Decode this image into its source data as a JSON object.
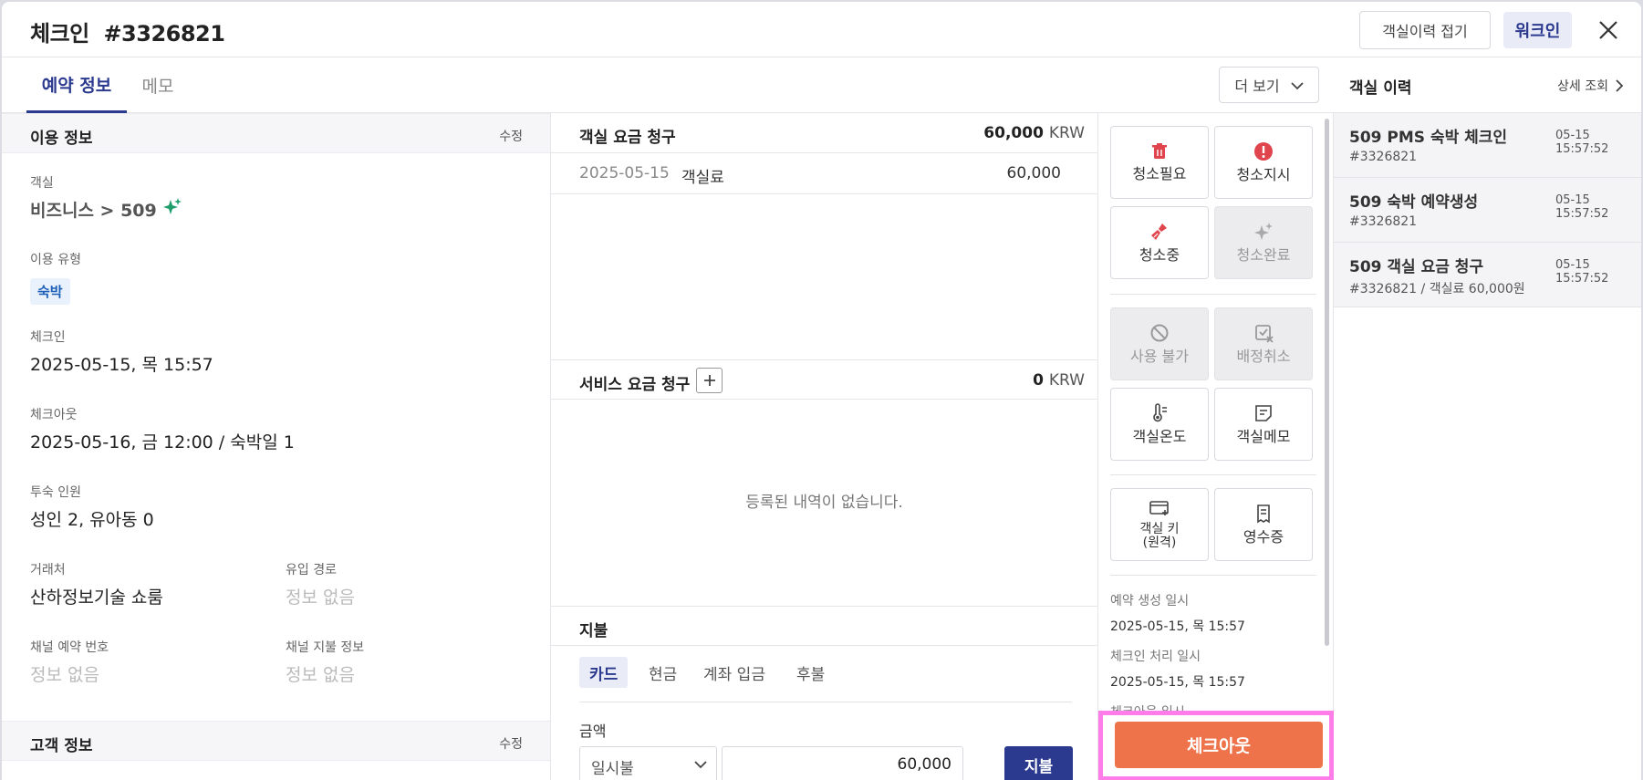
{
  "header": {
    "title": "체크인  #3326821",
    "history_toggle_label": "객실이력 접기",
    "walkin_label": "워크인"
  },
  "tabs": [
    {
      "label": "예약 정보"
    },
    {
      "label": "메모"
    }
  ],
  "more_label": "더 보기",
  "usage": {
    "title": "이용 정보",
    "edit_label": "수정",
    "room_label": "객실",
    "room_value": "비즈니스 > 509",
    "type_label": "이용 유형",
    "type_value": "숙박",
    "checkin_label": "체크인",
    "checkin_value": "2025-05-15, 목 15:57",
    "checkout_label": "체크아웃",
    "checkout_value": "2025-05-16, 금 12:00 / 숙박일 1",
    "guests_label": "투숙 인원",
    "guests_value": "성인 2, 유아동 0",
    "partner_label": "거래처",
    "partner_value": "산하정보기술 쇼룸",
    "inflow_label": "유입 경로",
    "inflow_value": "정보 없음",
    "channel_no_label": "채널 예약 번호",
    "channel_no_value": "정보 없음",
    "channel_pay_label": "채널 지불 정보",
    "channel_pay_value": "정보 없음"
  },
  "customer": {
    "title": "고객 정보",
    "edit_label": "수정"
  },
  "room_charge": {
    "title": "객실 요금 청구",
    "total": "60,000",
    "currency": "KRW",
    "rows": [
      {
        "date": "2025-05-15",
        "name": "객실료",
        "amount": "60,000"
      }
    ]
  },
  "service_charge": {
    "title": "서비스 요금 청구",
    "total": "0",
    "currency": "KRW",
    "empty_text": "등록된 내역이 없습니다."
  },
  "payment": {
    "title": "지불",
    "tabs": [
      "카드",
      "현금",
      "계좌 입금",
      "후불"
    ],
    "amount_label": "금액",
    "installment_value": "일시불",
    "amount_value": "60,000",
    "pay_label": "지불"
  },
  "actions": {
    "clean_needed": "청소필요",
    "clean_order": "청소지시",
    "cleaning": "청소중",
    "clean_done": "청소완료",
    "unavailable": "사용 불가",
    "unassign": "배정취소",
    "room_temp": "객실온도",
    "room_memo": "객실메모",
    "room_key_line1": "객실 키",
    "room_key_line2": "(원격)",
    "receipt": "영수증",
    "created_label": "예약 생성 일시",
    "created_value": "2025-05-15, 목 15:57",
    "checkin_proc_label": "체크인 처리 일시",
    "checkin_proc_value": "2025-05-15, 목 15:57",
    "checkout_proc_label": "체크아웃 일시",
    "checkout_label": "체크아웃"
  },
  "history": {
    "title": "객실 이력",
    "detail_label": "상세 조회",
    "items": [
      {
        "title": "509 PMS 숙박 체크인",
        "sub": "#3326821",
        "time": "05-15 15:57:52"
      },
      {
        "title": "509 숙박 예약생성",
        "sub": "#3326821",
        "time": "05-15 15:57:52"
      },
      {
        "title": "509 객실 요금 청구",
        "sub": "#3326821 / 객실료 60,000원",
        "time": "05-15 15:57:52"
      }
    ]
  },
  "colors": {
    "accent": "#2b3a8f",
    "checkout": "#ee734a",
    "highlight": "#ff7de8",
    "danger": "#e0454e",
    "room_sparkle": "#1f9d6b"
  }
}
